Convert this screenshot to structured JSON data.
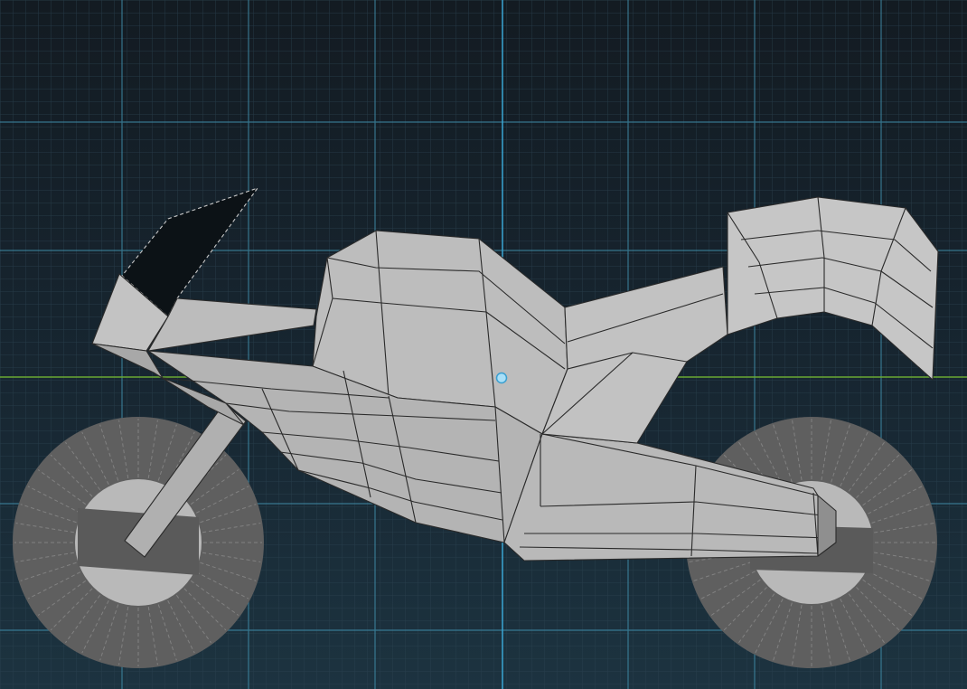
{
  "viewport": {
    "view": "side",
    "object": "motorcycle-lowpoly-mesh",
    "colors": {
      "background_top": "#131b22",
      "background_bottom": "#1c3340",
      "grid_minor": "#2f4756",
      "grid_major": "#3f8aa6",
      "axis_center": "#3aa6d4",
      "horizon": "#6aa832",
      "mesh_fill": "#b7b7b7",
      "mesh_edge": "#2a2a2a",
      "wheel_fill": "#5f5f5f",
      "hub_fill": "#b9b9b9",
      "pivot": "#5fc0ef"
    }
  }
}
